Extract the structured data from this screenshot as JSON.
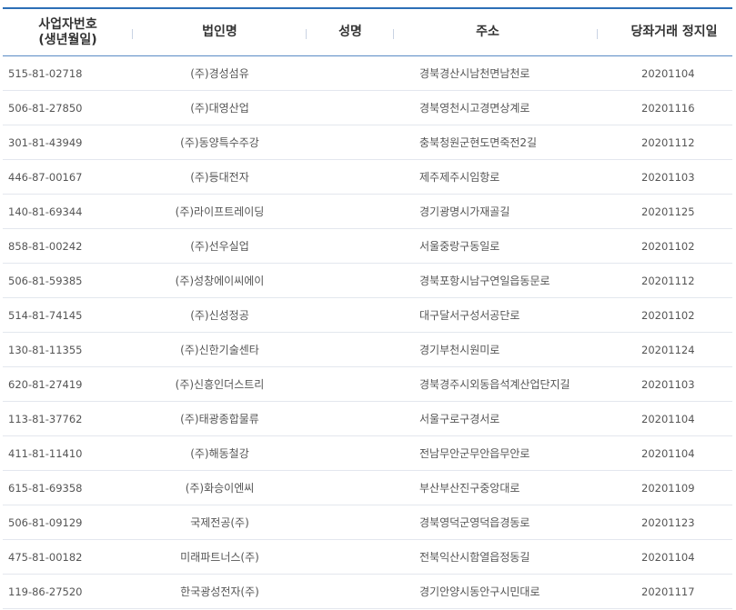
{
  "table": {
    "headers": {
      "biz_no_line1": "사업자번호",
      "biz_no_line2": "(생년월일)",
      "corp_name": "법인명",
      "person_name": "성명",
      "address": "주소",
      "suspension_date": "당좌거래 정지일"
    },
    "rows": [
      {
        "biz_no": "515-81-02718",
        "corp": "(주)경성섬유",
        "name": "",
        "addr": "경북경산시남천면남천로",
        "date": "20201104"
      },
      {
        "biz_no": "506-81-27850",
        "corp": "(주)대영산업",
        "name": "",
        "addr": "경북영천시고경면상계로",
        "date": "20201116"
      },
      {
        "biz_no": "301-81-43949",
        "corp": "(주)동양특수주강",
        "name": "",
        "addr": "충북청원군현도면죽전2길",
        "date": "20201112"
      },
      {
        "biz_no": "446-87-00167",
        "corp": "(주)등대전자",
        "name": "",
        "addr": "제주제주시임항로",
        "date": "20201103"
      },
      {
        "biz_no": "140-81-69344",
        "corp": "(주)라이프트레이딩",
        "name": "",
        "addr": "경기광명시가재골길",
        "date": "20201125"
      },
      {
        "biz_no": "858-81-00242",
        "corp": "(주)선우실업",
        "name": "",
        "addr": "서울중랑구동일로",
        "date": "20201102"
      },
      {
        "biz_no": "506-81-59385",
        "corp": "(주)성창에이씨에이",
        "name": "",
        "addr": "경북포항시남구연일읍동문로",
        "date": "20201112"
      },
      {
        "biz_no": "514-81-74145",
        "corp": "(주)신성정공",
        "name": "",
        "addr": "대구달서구성서공단로",
        "date": "20201102"
      },
      {
        "biz_no": "130-81-11355",
        "corp": "(주)신한기술센타",
        "name": "",
        "addr": "경기부천시원미로",
        "date": "20201124"
      },
      {
        "biz_no": "620-81-27419",
        "corp": "(주)신흥인더스트리",
        "name": "",
        "addr": "경북경주시외동읍석계산업단지길",
        "date": "20201103"
      },
      {
        "biz_no": "113-81-37762",
        "corp": "(주)태광종합물류",
        "name": "",
        "addr": "서울구로구경서로",
        "date": "20201104"
      },
      {
        "biz_no": "411-81-11410",
        "corp": "(주)해동철강",
        "name": "",
        "addr": "전남무안군무안읍무안로",
        "date": "20201104"
      },
      {
        "biz_no": "615-81-69358",
        "corp": "(주)화승이엔씨",
        "name": "",
        "addr": "부산부산진구중앙대로",
        "date": "20201109"
      },
      {
        "biz_no": "506-81-09129",
        "corp": "국제전공(주)",
        "name": "",
        "addr": "경북영덕군영덕읍경동로",
        "date": "20201123"
      },
      {
        "biz_no": "475-81-00182",
        "corp": "미래파트너스(주)",
        "name": "",
        "addr": "전북익산시함열읍정동길",
        "date": "20201104"
      },
      {
        "biz_no": "119-86-27520",
        "corp": "한국광성전자(주)",
        "name": "",
        "addr": "경기안양시동안구시민대로",
        "date": "20201117"
      }
    ]
  },
  "colors": {
    "header_line": "#2d6fb7",
    "row_divider": "#e3e7ee"
  }
}
